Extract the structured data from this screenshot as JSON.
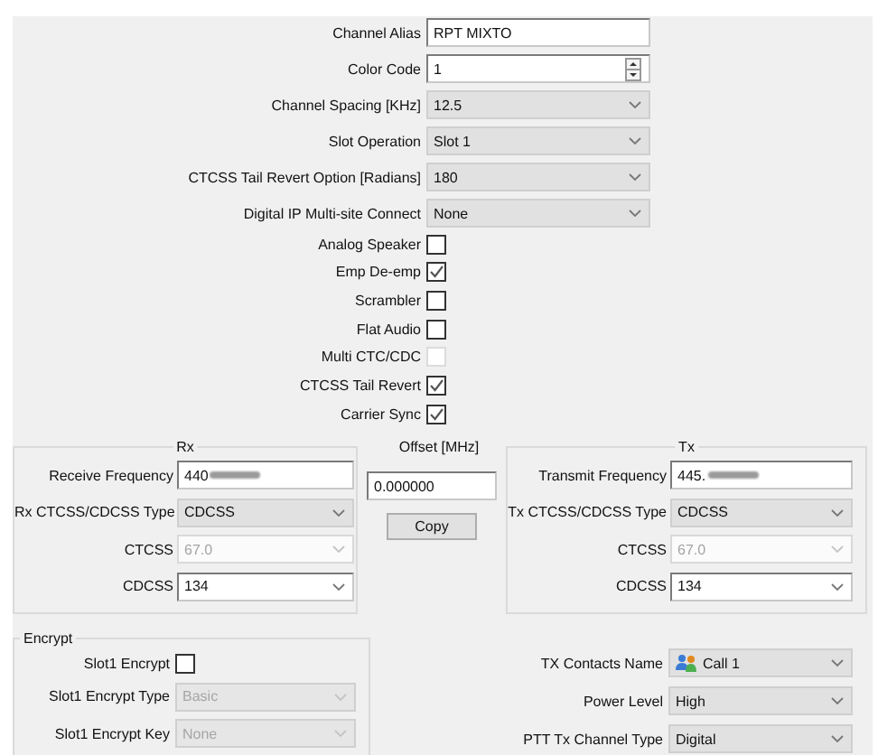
{
  "form": {
    "fields": [
      {
        "label": "Channel Alias",
        "kind": "text",
        "value": "RPT MIXTO"
      },
      {
        "label": "Color Code",
        "kind": "spin",
        "value": "1"
      },
      {
        "label": "Channel Spacing [KHz]",
        "kind": "dropdown",
        "value": "12.5"
      },
      {
        "label": "Slot Operation",
        "kind": "dropdown",
        "value": "Slot 1"
      },
      {
        "label": "CTCSS Tail Revert Option [Radians]",
        "kind": "dropdown",
        "value": "180"
      },
      {
        "label": "Digital IP Multi-site Connect",
        "kind": "dropdown",
        "value": "None"
      }
    ],
    "checkboxes": [
      {
        "label": "Analog Speaker",
        "checked": false,
        "disabled": false
      },
      {
        "label": "Emp De-emp",
        "checked": true,
        "disabled": false
      },
      {
        "label": "Scrambler",
        "checked": false,
        "disabled": false
      },
      {
        "label": "Flat Audio",
        "checked": false,
        "disabled": false
      },
      {
        "label": "Multi CTC/CDC",
        "checked": false,
        "disabled": true
      },
      {
        "label": "CTCSS Tail Revert",
        "checked": true,
        "disabled": false
      },
      {
        "label": "Carrier Sync",
        "checked": true,
        "disabled": false
      }
    ]
  },
  "rx": {
    "title": "Rx",
    "fields": [
      {
        "label": "Receive Frequency",
        "kind": "text",
        "value": "440",
        "redacted": true
      },
      {
        "label": "Rx CTCSS/CDCSS Type",
        "kind": "dropdown",
        "value": "CDCSS",
        "disabled": false
      },
      {
        "label": "CTCSS",
        "kind": "combo",
        "value": "67.0",
        "disabled": true
      },
      {
        "label": "CDCSS",
        "kind": "combo",
        "value": "134",
        "disabled": false
      }
    ]
  },
  "offset": {
    "label": "Offset [MHz]",
    "value": "0.000000",
    "button": "Copy"
  },
  "tx": {
    "title": "Tx",
    "fields": [
      {
        "label": "Transmit Frequency",
        "kind": "text",
        "value": "445.",
        "redacted": true
      },
      {
        "label": "Tx CTCSS/CDCSS Type",
        "kind": "dropdown",
        "value": "CDCSS",
        "disabled": false
      },
      {
        "label": "CTCSS",
        "kind": "combo",
        "value": "67.0",
        "disabled": true
      },
      {
        "label": "CDCSS",
        "kind": "combo",
        "value": "134",
        "disabled": false
      }
    ]
  },
  "encrypt": {
    "title": "Encrypt",
    "fields": [
      {
        "label": "Slot1 Encrypt",
        "kind": "checkbox",
        "checked": false,
        "disabled": false
      },
      {
        "label": "Slot1 Encrypt Type",
        "kind": "dropdown",
        "value": "Basic",
        "disabled": true
      },
      {
        "label": "Slot1 Encrypt Key",
        "kind": "dropdown",
        "value": "None",
        "disabled": true
      }
    ]
  },
  "tx_settings": [
    {
      "label": "TX Contacts Name",
      "kind": "contact",
      "value": "Call 1"
    },
    {
      "label": "Power Level",
      "kind": "dropdown",
      "value": "High"
    },
    {
      "label": "PTT Tx Channel Type",
      "kind": "dropdown",
      "value": "Digital"
    }
  ]
}
